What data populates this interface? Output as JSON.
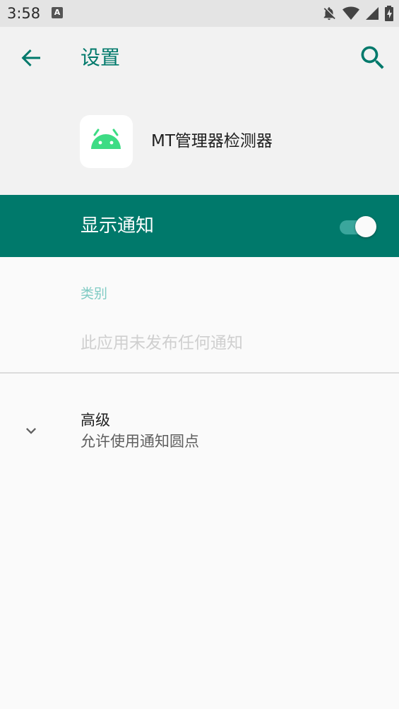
{
  "status_bar": {
    "time": "3:58",
    "notification_icon_letter": "A",
    "icons": [
      "notifications-off-icon",
      "wifi-icon",
      "cellular-signal-icon",
      "battery-charging-icon"
    ]
  },
  "app_bar": {
    "title": "设置",
    "back_icon": "arrow-back-icon",
    "search_icon": "search-icon",
    "accent_color": "#00796b"
  },
  "app_info": {
    "name": "MT管理器检测器",
    "icon": "android-robot-icon",
    "icon_color": "#3ddc84"
  },
  "master_switch": {
    "label": "显示通知",
    "checked": true,
    "background_color": "#00796b"
  },
  "category": {
    "header": "类别",
    "empty_message": "此应用未发布任何通知"
  },
  "advanced": {
    "title": "高级",
    "summary": "允许使用通知圆点",
    "icon": "chevron-down-icon"
  }
}
